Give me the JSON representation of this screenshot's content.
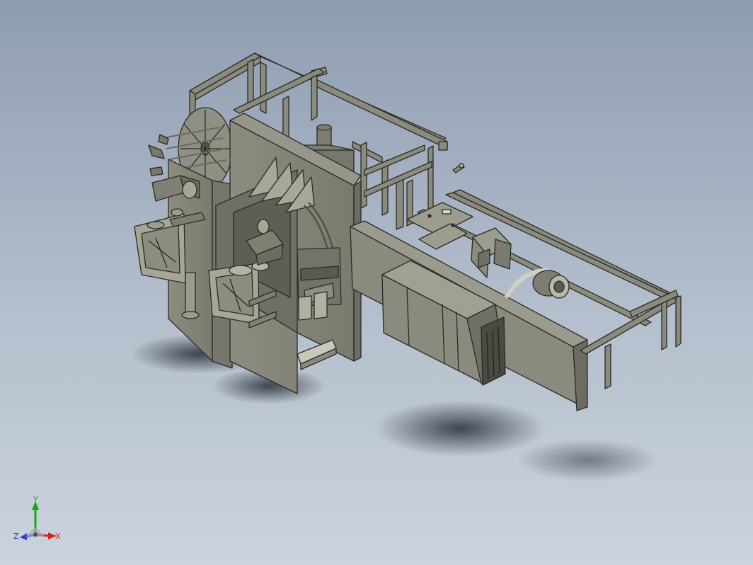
{
  "viewport": {
    "background_top": "#8f9db1",
    "background_bottom": "#cbd3dd",
    "model_color": "#8a8a7e",
    "model_edge_color": "#2b2b26"
  },
  "triad": {
    "y_label": "Y",
    "x_label": "X",
    "z_label": "Z",
    "y_color": "#1aa51a",
    "x_color": "#d62424",
    "z_color": "#2a3fd1"
  }
}
